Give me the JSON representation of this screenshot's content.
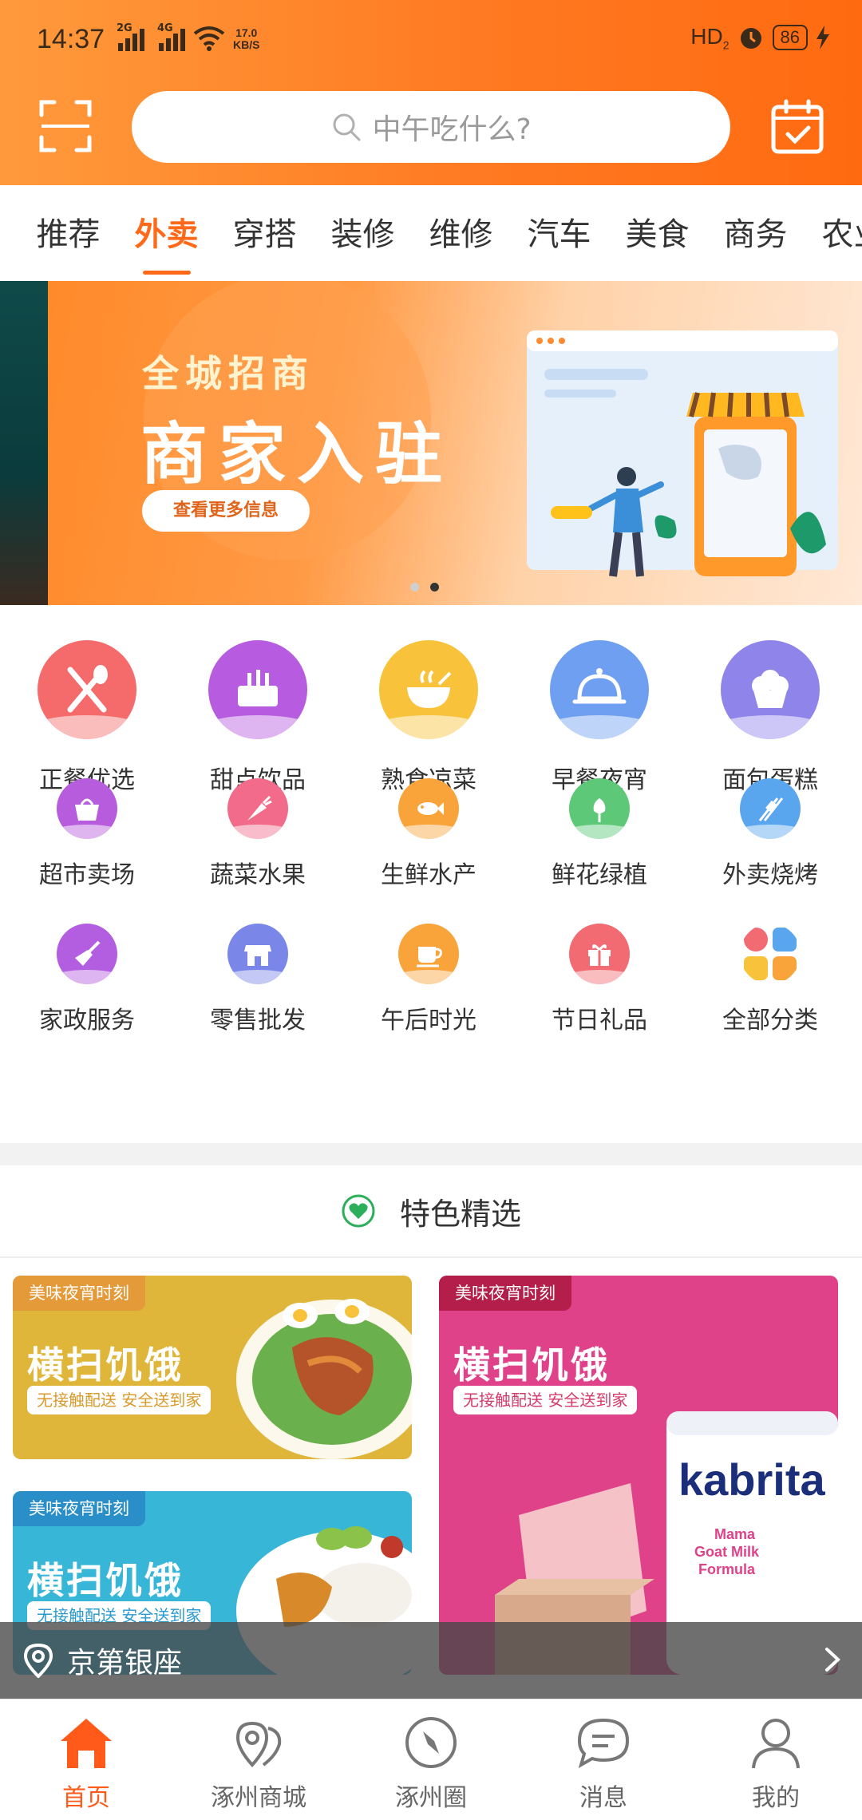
{
  "status_bar": {
    "time": "14:37",
    "net1": "2G",
    "net2": "4G",
    "speed_value": "17.0",
    "speed_unit": "KB/S",
    "hd": "HD",
    "hd_sub": "2",
    "battery": "86"
  },
  "search": {
    "placeholder": "中午吃什么?"
  },
  "tabs": [
    {
      "label": "推荐"
    },
    {
      "label": "外卖",
      "active": true
    },
    {
      "label": "穿搭"
    },
    {
      "label": "装修"
    },
    {
      "label": "维修"
    },
    {
      "label": "汽车"
    },
    {
      "label": "美食"
    },
    {
      "label": "商务"
    },
    {
      "label": "农业"
    }
  ],
  "banner": {
    "subtitle": "全城招商",
    "title": "商家入驻",
    "button": "查看更多信息",
    "page_count": 2,
    "active_page": 2
  },
  "categories": [
    {
      "label": "正餐优选",
      "icon": "fork-knife-icon",
      "color": "#f56b6b"
    },
    {
      "label": "甜点饮品",
      "icon": "cake-candles-icon",
      "color": "#b75be0"
    },
    {
      "label": "熟食凉菜",
      "icon": "bowl-steam-icon",
      "color": "#f8c23a"
    },
    {
      "label": "早餐夜宵",
      "icon": "cloche-icon",
      "color": "#6f9ff0"
    },
    {
      "label": "面包蛋糕",
      "icon": "cupcake-icon",
      "color": "#8e84ea"
    },
    {
      "label": "超市卖场",
      "icon": "basket-icon",
      "color": "#b65cdc"
    },
    {
      "label": "蔬菜水果",
      "icon": "carrot-icon",
      "color": "#f26b8a"
    },
    {
      "label": "生鲜水产",
      "icon": "fish-icon",
      "color": "#f8a43a"
    },
    {
      "label": "鲜花绿植",
      "icon": "flower-icon",
      "color": "#5cc878"
    },
    {
      "label": "外卖烧烤",
      "icon": "skewer-icon",
      "color": "#5aa6ee"
    },
    {
      "label": "家政服务",
      "icon": "broom-icon",
      "color": "#b35ee0"
    },
    {
      "label": "零售批发",
      "icon": "store-icon",
      "color": "#7a86e8"
    },
    {
      "label": "午后时光",
      "icon": "cup-icon",
      "color": "#f8a43a"
    },
    {
      "label": "节日礼品",
      "icon": "gift-icon",
      "color": "#f26a72"
    },
    {
      "label": "全部分类",
      "icon": "all-categories-icon",
      "color": "#f26a72"
    }
  ],
  "featured": {
    "title": "特色精选",
    "cards": [
      {
        "tag": "美味夜宵时刻",
        "title": "横扫饥饿",
        "subtitle": "无接触配送 安全送到家",
        "bg": "#e0b63a",
        "tag_bg": "#e59a3a"
      },
      {
        "tag": "美味夜宵时刻",
        "title": "横扫饥饿",
        "subtitle": "无接触配送 安全送到家",
        "bg": "#e0428a",
        "tag_bg": "#b31e4a",
        "brand": "kabrita",
        "product": "Mama Goat Milk Formula"
      },
      {
        "tag": "美味夜宵时刻",
        "title": "横扫饥饿",
        "subtitle": "无接触配送 安全送到家",
        "bg": "#38b6d8",
        "tag_bg": "#2a8fc8"
      }
    ]
  },
  "location": {
    "name": "京第银座"
  },
  "bottom_nav": [
    {
      "label": "首页",
      "icon": "home-icon",
      "active": true
    },
    {
      "label": "涿州商城",
      "icon": "map-pin-icon"
    },
    {
      "label": "涿州圈",
      "icon": "compass-icon"
    },
    {
      "label": "消息",
      "icon": "message-icon"
    },
    {
      "label": "我的",
      "icon": "user-icon"
    }
  ],
  "colors": {
    "accent": "#ff6a1a",
    "header_start": "#ff9a3c",
    "header_end": "#ff6a10"
  }
}
